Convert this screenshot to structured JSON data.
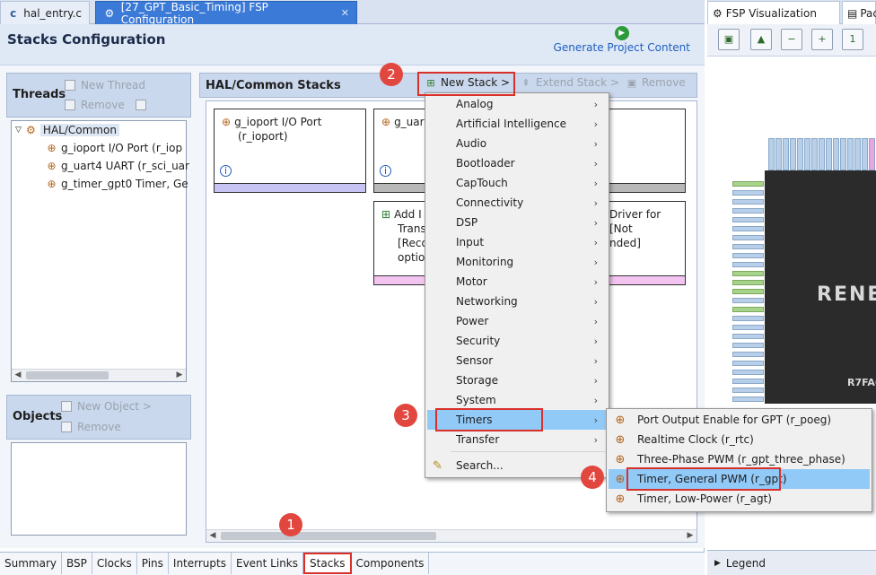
{
  "editor_tabs": [
    {
      "label": "hal_entry.c",
      "icon": "c-file-icon"
    },
    {
      "label": "[27_GPT_Basic_Timing] FSP Configuration",
      "icon": "gear-icon"
    }
  ],
  "header": {
    "title": "Stacks Configuration",
    "generate_label": "Generate Project Content"
  },
  "threads": {
    "title": "Threads",
    "new_thread": "New Thread",
    "remove": "Remove",
    "tree": [
      {
        "label": "HAL/Common"
      },
      {
        "label": "g_ioport I/O Port (r_iop"
      },
      {
        "label": "g_uart4 UART (r_sci_uar"
      },
      {
        "label": "g_timer_gpt0 Timer, Ge"
      }
    ]
  },
  "objects": {
    "title": "Objects",
    "new_object": "New Object >",
    "remove": "Remove"
  },
  "hal_stacks": {
    "title": "HAL/Common Stacks",
    "new_stack": "New Stack >",
    "extend_stack": "Extend Stack >",
    "remove": "Remove",
    "cards": [
      {
        "line1": "g_ioport I/O Port",
        "line2": "(r_ioport)",
        "bar_color": "#c7c4f4"
      },
      {
        "line1": "g_uar",
        "line2": "",
        "bar_color": "#b8b8b8"
      },
      {
        "line1": "Add I",
        "line2": "Trans",
        "line3": "[Reco",
        "line4": "optio",
        "right1": "Driver for",
        "right2": "[Not",
        "right3": "nded]",
        "bar_color": "#f4c4f0"
      }
    ]
  },
  "new_stack_menu": [
    "Analog",
    "Artificial Intelligence",
    "Audio",
    "Bootloader",
    "CapTouch",
    "Connectivity",
    "DSP",
    "Input",
    "Monitoring",
    "Motor",
    "Networking",
    "Power",
    "Security",
    "Sensor",
    "Storage",
    "System",
    "Timers",
    "Transfer"
  ],
  "search_label": "Search...",
  "timers_submenu": [
    "Port Output Enable for GPT (r_poeg)",
    "Realtime Clock (r_rtc)",
    "Three-Phase PWM (r_gpt_three_phase)",
    "Timer, General PWM (r_gpt)",
    "Timer, Low-Power (r_agt)"
  ],
  "bottom_tabs": [
    "Summary",
    "BSP",
    "Clocks",
    "Pins",
    "Interrupts",
    "Event Links",
    "Stacks",
    "Components"
  ],
  "right_panel": {
    "tab1": "FSP Visualization",
    "tab2": "Pac",
    "chip_logo": "RENE",
    "chip_part": "R7FA6",
    "legend": "Legend"
  },
  "steps": [
    "1",
    "2",
    "3",
    "4"
  ],
  "colors": {
    "accent": "#3b7ad6",
    "highlight": "#91c9f7",
    "callout": "#d9302a"
  }
}
